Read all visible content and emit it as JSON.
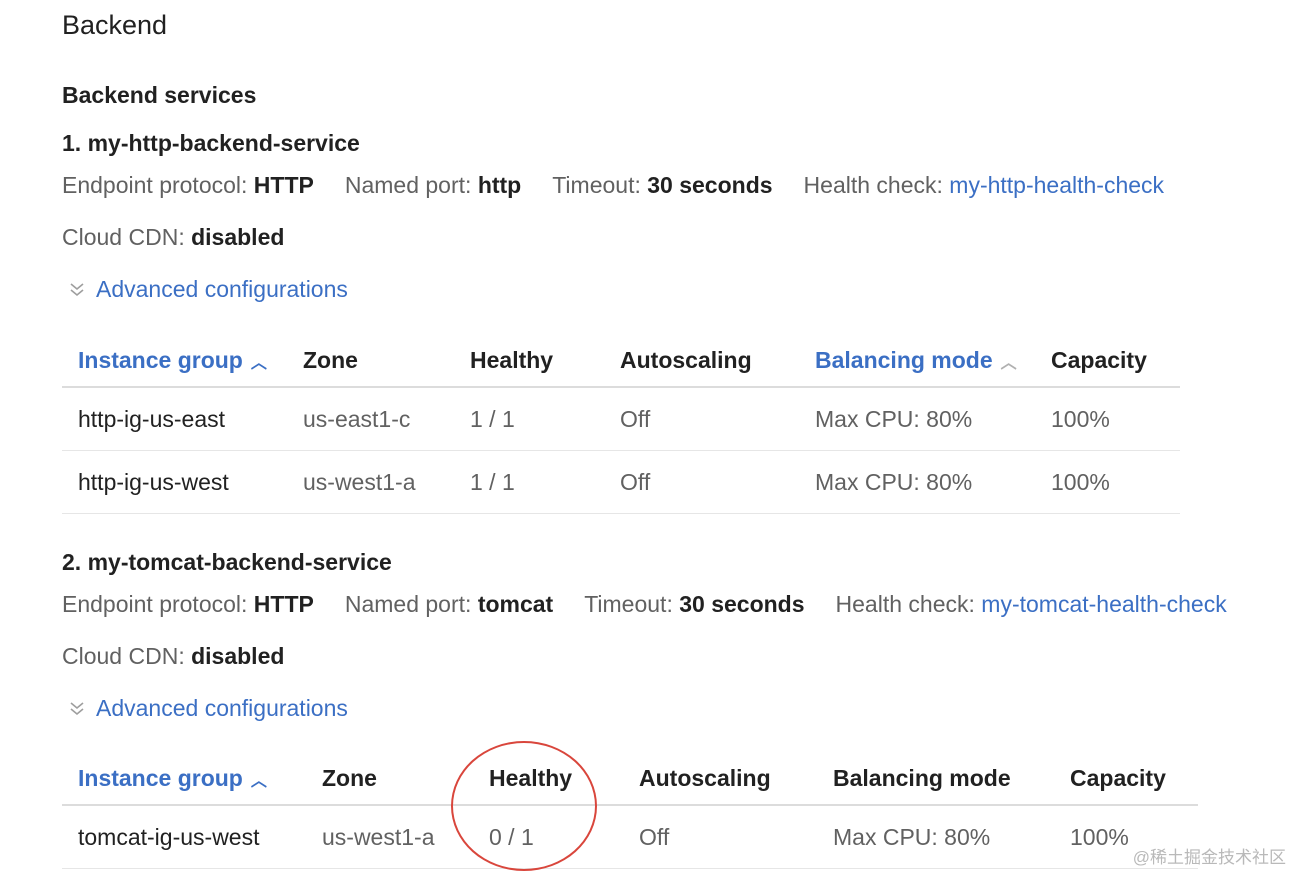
{
  "page_title": "Backend",
  "section_title": "Backend services",
  "services": [
    {
      "name": "1. my-http-backend-service",
      "endpoint_protocol": {
        "label": "Endpoint protocol:",
        "value": "HTTP"
      },
      "named_port": {
        "label": "Named port:",
        "value": "http"
      },
      "timeout": {
        "label": "Timeout:",
        "value": "30 seconds"
      },
      "health_check": {
        "label": "Health check:",
        "value": "my-http-health-check"
      },
      "cloud_cdn": {
        "label": "Cloud CDN:",
        "value": "disabled"
      },
      "advanced_label": "Advanced configurations",
      "table": {
        "headers": [
          "Instance group",
          "Zone",
          "Healthy",
          "Autoscaling",
          "Balancing mode",
          "Capacity"
        ],
        "rows": [
          [
            "http-ig-us-east",
            "us-east1-c",
            "1 / 1",
            "Off",
            "Max CPU: 80%",
            "100%"
          ],
          [
            "http-ig-us-west",
            "us-west1-a",
            "1 / 1",
            "Off",
            "Max CPU: 80%",
            "100%"
          ]
        ]
      }
    },
    {
      "name": "2. my-tomcat-backend-service",
      "endpoint_protocol": {
        "label": "Endpoint protocol:",
        "value": "HTTP"
      },
      "named_port": {
        "label": "Named port:",
        "value": "tomcat"
      },
      "timeout": {
        "label": "Timeout:",
        "value": "30 seconds"
      },
      "health_check": {
        "label": "Health check:",
        "value": "my-tomcat-health-check"
      },
      "cloud_cdn": {
        "label": "Cloud CDN:",
        "value": "disabled"
      },
      "advanced_label": "Advanced configurations",
      "table": {
        "headers": [
          "Instance group",
          "Zone",
          "Healthy",
          "Autoscaling",
          "Balancing mode",
          "Capacity"
        ],
        "rows": [
          [
            "tomcat-ig-us-west",
            "us-west1-a",
            "0 / 1",
            "Off",
            "Max CPU: 80%",
            "100%"
          ]
        ]
      }
    }
  ],
  "icons": {
    "sort_up": "chevron-up-icon",
    "expand": "double-chevron-down-icon"
  },
  "colors": {
    "link": "#3b6fc4",
    "annotation_circle": "#d9463c"
  },
  "watermark": "@稀土掘金技术社区"
}
